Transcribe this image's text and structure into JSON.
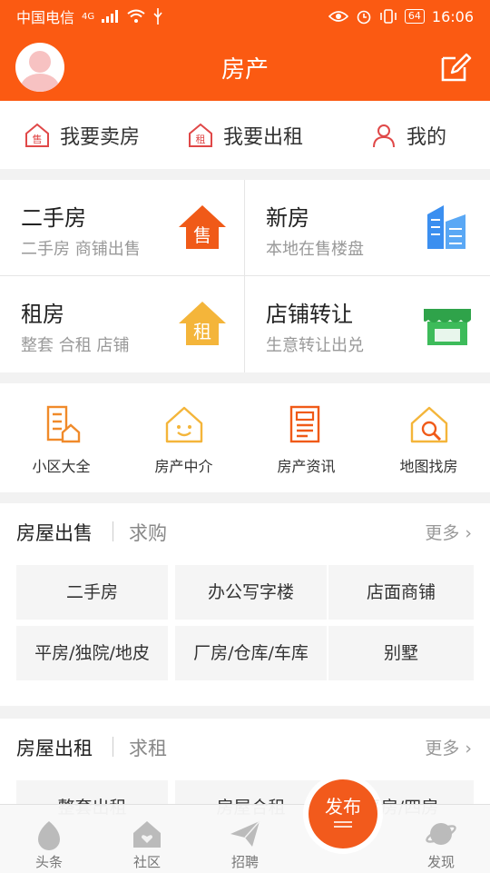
{
  "status_bar": {
    "carrier": "中国电信",
    "network": "4G",
    "battery": "64",
    "time": "16:06"
  },
  "header": {
    "title": "房产"
  },
  "quick_actions": [
    {
      "label": "我要卖房",
      "icon": "sell-badge-icon"
    },
    {
      "label": "我要出租",
      "icon": "rent-badge-icon"
    },
    {
      "label": "我的",
      "icon": "user-icon"
    }
  ],
  "categories": [
    {
      "title": "二手房",
      "subtitle": "二手房 商铺出售",
      "icon": "sell-house-icon"
    },
    {
      "title": "新房",
      "subtitle": "本地在售楼盘",
      "icon": "buildings-icon"
    },
    {
      "title": "租房",
      "subtitle": "整套 合租 店铺",
      "icon": "rent-house-icon"
    },
    {
      "title": "店铺转让",
      "subtitle": "生意转让出兑",
      "icon": "storefront-icon"
    }
  ],
  "shortcuts": [
    {
      "label": "小区大全",
      "icon": "community-icon"
    },
    {
      "label": "房产中介",
      "icon": "agency-house-icon"
    },
    {
      "label": "房产资讯",
      "icon": "news-icon"
    },
    {
      "label": "地图找房",
      "icon": "map-search-icon"
    }
  ],
  "sale_section": {
    "title": "房屋出售",
    "secondary": "求购",
    "more": "更多",
    "chips": [
      "二手房",
      "办公写字楼",
      "店面商铺",
      "平房/独院/地皮",
      "厂房/仓库/车库",
      "别墅"
    ]
  },
  "rent_section": {
    "title": "房屋出租",
    "secondary": "求租",
    "more": "更多",
    "chips": [
      "整套出租",
      "房屋合租",
      "平房/四房"
    ]
  },
  "bottom_nav": [
    {
      "label": "头条",
      "icon": "headline-icon"
    },
    {
      "label": "社区",
      "icon": "community-house-icon"
    },
    {
      "label": "招聘",
      "icon": "paper-plane-icon"
    },
    {
      "label": "发现",
      "icon": "planet-icon"
    }
  ],
  "publish_button": {
    "label": "发布"
  },
  "colors": {
    "brand": "#fb5a12",
    "sell": "#f05a18",
    "rent": "#f4b53a",
    "building": "#3b8ff0",
    "store": "#3dbb5a"
  }
}
